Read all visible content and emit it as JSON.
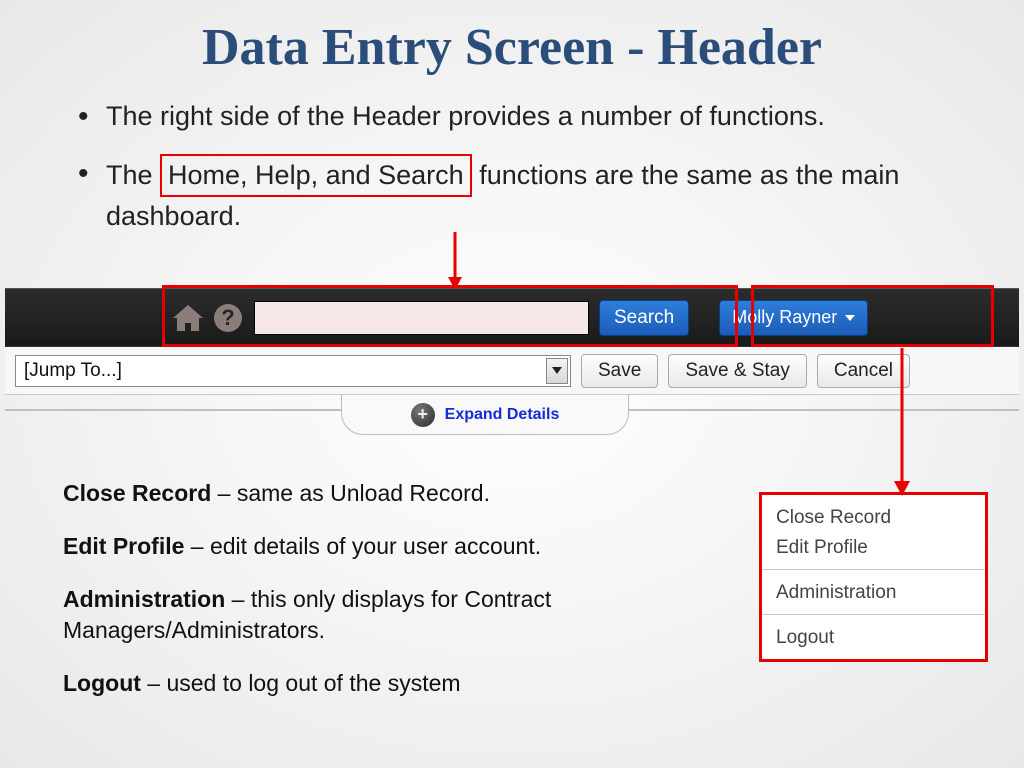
{
  "title": "Data Entry Screen - Header",
  "bullets": {
    "b1": "The right side of the Header provides a number of functions.",
    "b2_pre": "The ",
    "b2_box": "Home, Help, and Search",
    "b2_post": " functions are the same as the main dashboard."
  },
  "header": {
    "search_button": "Search",
    "user_name": "Molly Rayner"
  },
  "toolbar": {
    "jump_label": "[Jump To...]",
    "save": "Save",
    "save_stay": "Save & Stay",
    "cancel": "Cancel",
    "expand": "Expand Details"
  },
  "menu": {
    "close_record": "Close Record",
    "edit_profile": "Edit Profile",
    "administration": "Administration",
    "logout": "Logout"
  },
  "defs": {
    "d1b": "Close Record",
    "d1": " – same as Unload Record.",
    "d2b": "Edit Profile",
    "d2": " – edit details of your user account.",
    "d3b": "Administration",
    "d3": " – this only displays for Contract Managers/Administrators.",
    "d4b": "Logout",
    "d4": " – used to log out of the system"
  }
}
